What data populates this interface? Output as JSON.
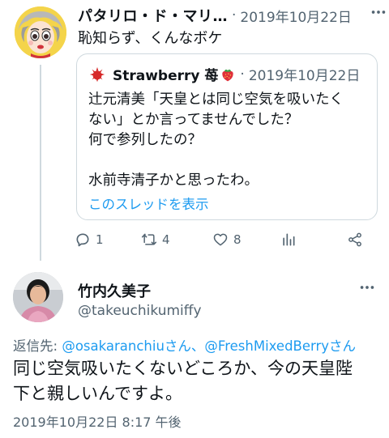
{
  "colors": {
    "text": "#0f1419",
    "secondary": "#536471",
    "link": "#1d9bf0",
    "border": "#cfd9de"
  },
  "tweet1": {
    "author_name": "パタリロ・ド・マリ…",
    "separator": "·",
    "date": "2019年10月22日",
    "more_icon": "more-horizontal-icon",
    "text": "恥知らず、くんなボケ",
    "quote": {
      "author_name": "Strawberry 苺",
      "date": "2019年10月22日",
      "lines": [
        "辻元清美「天皇とは同じ空気を吸いたく",
        "ない」とか言ってませんでした？",
        "何で参列したの？",
        "",
        "水前寺清子かと思ったわ。"
      ],
      "thread_link": "このスレッドを表示"
    },
    "actions": {
      "reply_count": "1",
      "retweet_count": "4",
      "like_count": "8"
    }
  },
  "tweet2": {
    "author_name": "竹内久美子",
    "handle": "@takeuchikumiffy",
    "reply_prefix": "返信先: ",
    "mention1": "@osakaranchiuさん",
    "mention_sep": "、",
    "mention2": "@FreshMixedBerryさん",
    "text_line1": "同じ空気吸いたくないどころか、今の天皇陛",
    "text_line2": "下と親しいんですよ。",
    "timestamp": "2019年10月22日 8:17 午後"
  }
}
